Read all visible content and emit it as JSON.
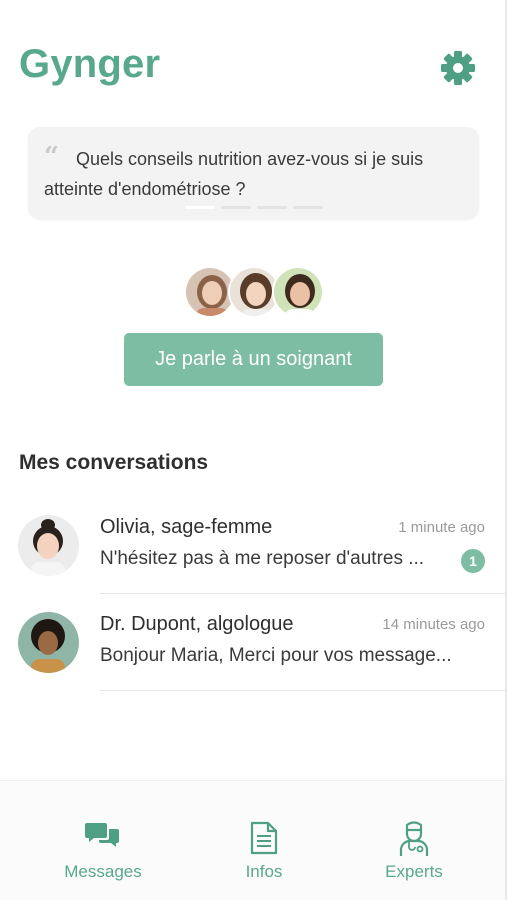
{
  "app": {
    "title": "Gynger"
  },
  "header": {
    "settings_icon": "gear-icon",
    "accent_color": "#58a88d"
  },
  "quote": {
    "icon": "quote-icon",
    "text": "Quels conseils nutrition avez-vous si je suis atteinte d'endométriose ?"
  },
  "cta": {
    "label": "Je parle à un soignant",
    "color": "#7cbda4"
  },
  "conversations": {
    "title": "Mes conversations",
    "items": [
      {
        "name": "Olivia, sage-femme",
        "time": "1 minute ago",
        "preview": "N'hésitez pas à me reposer d'autres ...",
        "unread": "1"
      },
      {
        "name": "Dr. Dupont, algologue",
        "time": "14 minutes ago",
        "preview": "Bonjour Maria, Merci pour vos message..."
      }
    ]
  },
  "tabbar": {
    "tabs": [
      {
        "label": "Messages",
        "icon": "chat-bubbles-icon"
      },
      {
        "label": "Infos",
        "icon": "document-icon"
      },
      {
        "label": "Experts",
        "icon": "doctor-icon"
      }
    ]
  }
}
